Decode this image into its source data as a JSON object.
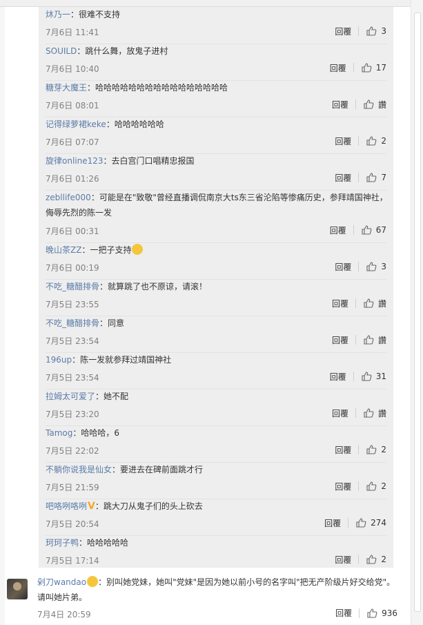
{
  "replies": [
    {
      "user": "炑乃一",
      "text": "：很难不支持",
      "time": "7月6日 11:41",
      "reply_label": "回覆",
      "likes": "3"
    },
    {
      "user": "SOUILD",
      "text": "：跳什么舞，放鬼子进村",
      "time": "7月6日 10:40",
      "reply_label": "回覆",
      "likes": "17"
    },
    {
      "user": "糖芽大魔王",
      "text": "：哈哈哈哈哈哈哈哈哈哈哈哈哈哈哈哈",
      "time": "7月6日 08:01",
      "reply_label": "回覆",
      "likes": "讚"
    },
    {
      "user": "记得绿萝裙keke",
      "text": "：哈哈哈哈哈哈",
      "time": "7月6日 07:07",
      "reply_label": "回覆",
      "likes": "2"
    },
    {
      "user": "旋律online123",
      "text": "：去白宫门口唱精忠报国",
      "time": "7月6日 01:26",
      "reply_label": "回覆",
      "likes": "7"
    },
    {
      "user": "zebllife000",
      "text": "：可能是在\"致敬\"曾经直播调侃南京大ts东三省沦陷等惨痛历史，参拜靖国神社，侮辱先烈的陈一发",
      "time": "7月6日 00:31",
      "reply_label": "回覆",
      "likes": "67"
    },
    {
      "user": "晚山茶ZZ",
      "text": "：一把子支持",
      "time": "7月6日 00:19",
      "reply_label": "回覆",
      "likes": "3"
    },
    {
      "user": "不吃_糖醋排骨",
      "text": "：就算跳了也不原谅，请滚！",
      "time": "7月5日 23:55",
      "reply_label": "回覆",
      "likes": "讚"
    },
    {
      "user": "不吃_糖醋排骨",
      "text": "：同意",
      "time": "7月5日 23:54",
      "reply_label": "回覆",
      "likes": "讚"
    },
    {
      "user": "196up",
      "text": "：陈一发就参拜过靖国神社",
      "time": "7月5日 23:54",
      "reply_label": "回覆",
      "likes": "31"
    },
    {
      "user": "拉姆太可爱了",
      "text": "：她不配",
      "time": "7月5日 23:20",
      "reply_label": "回覆",
      "likes": "讚"
    },
    {
      "user": "Tamog",
      "text": "：哈哈哈，6",
      "time": "7月5日 22:02",
      "reply_label": "回覆",
      "likes": "2"
    },
    {
      "user": "不躺你说我是仙女",
      "text": "：要进去在碑前面跳才行",
      "time": "7月5日 21:59",
      "reply_label": "回覆",
      "likes": "2"
    },
    {
      "user": "吧咯咧咯咧",
      "text": "：跳大刀从鬼子们的头上砍去",
      "time": "7月5日 20:54",
      "reply_label": "回覆",
      "likes": "274"
    },
    {
      "user": "珂珂子鸭",
      "text": "：哈哈哈哈哈",
      "time": "7月5日 17:14",
      "reply_label": "回覆",
      "likes": "2"
    }
  ],
  "main_comment": {
    "user": "剁刀wandao",
    "text": "：别叫她党妹，她叫\"党妹\"是因为她以前小号的名字叫\"把无产阶级片好交给党\"。请叫她片弟。",
    "time": "7月4日 20:59",
    "reply_label": "回覆",
    "likes": "936"
  },
  "colors": {
    "username": "#eb7350",
    "username_blue": "#5a7ba8",
    "panel_bg": "#eeeeee",
    "time": "#808080"
  }
}
